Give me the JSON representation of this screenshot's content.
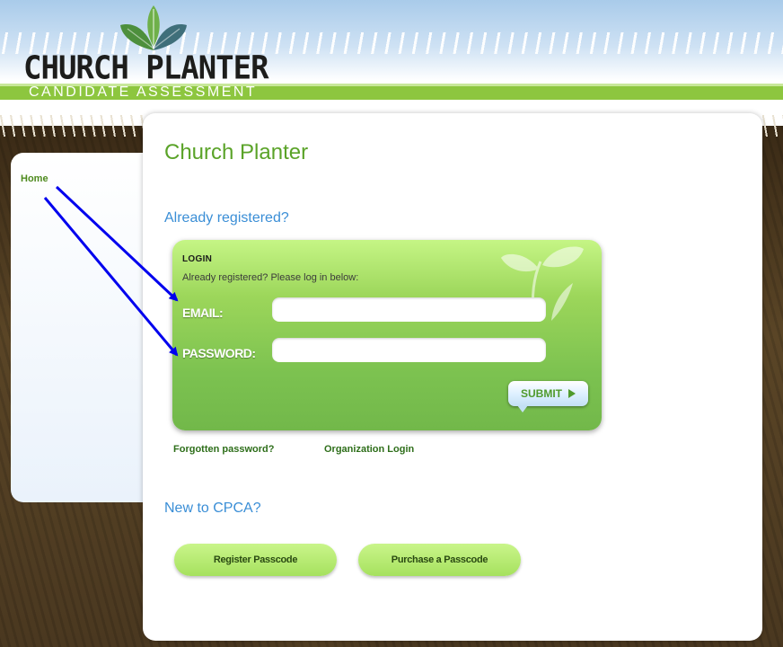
{
  "header": {
    "logo_name": "CHURCH PLANTER",
    "logo_tagline": "CANDIDATE ASSESSMENT"
  },
  "sidebar": {
    "items": [
      {
        "label": "Home"
      }
    ]
  },
  "main": {
    "page_title": "Church Planter",
    "registered_heading": "Already registered?",
    "login": {
      "title": "LOGIN",
      "subtitle": "Already registered? Please log in below:",
      "email_label": "EMAIL:",
      "email_value": "",
      "password_label": "PASSWORD:",
      "password_value": "",
      "submit_label": "SUBMIT"
    },
    "links": {
      "forgot_password": "Forgotten password?",
      "organization_login": "Organization Login"
    },
    "new_heading": "New to CPCA?",
    "buttons": {
      "register_passcode": "Register Passcode",
      "purchase_passcode": "Purchase a Passcode"
    }
  },
  "colors": {
    "accent_green": "#5aa328",
    "heading_blue": "#3a8ed6",
    "login_box_green": "#8dcc56",
    "annotation_arrow": "#0000ee"
  },
  "icons": {
    "logo": "leaf-logo-icon",
    "submit": "play-arrow-icon",
    "decoration": "sprout-icon",
    "annotation": "arrow-icon"
  }
}
